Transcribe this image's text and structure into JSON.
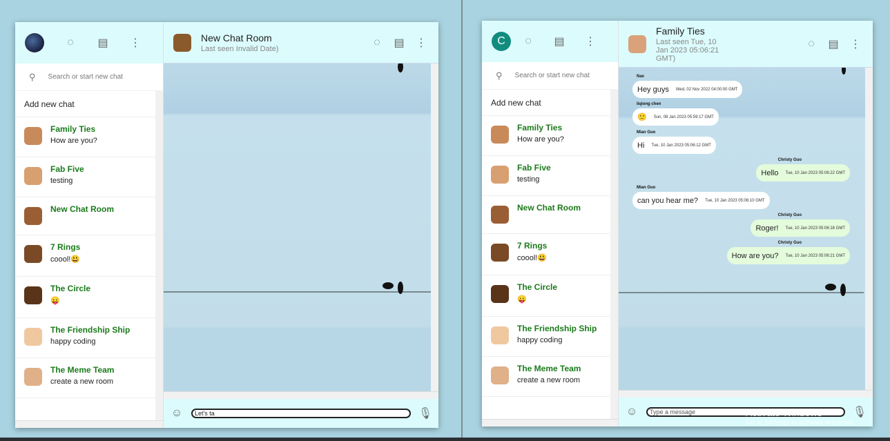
{
  "left": {
    "search_placeholder": "Search or start new chat",
    "add_new": "Add new chat",
    "chat_title": "New Chat Room",
    "chat_sub": "Last seen Invalid Date)",
    "input_value": "Let's ta"
  },
  "right": {
    "avatar_letter": "C",
    "search_placeholder": "Search or start new chat",
    "add_new": "Add new chat",
    "chat_title": "Family Ties",
    "chat_sub": "Last seen Tue, 10 Jan 2023 05:06:21 GMT)",
    "input_placeholder": "Type a message",
    "messages": [
      {
        "sender": "Nax",
        "text": "Hey guys",
        "time": "Wed, 02 Nov 2022 04:00:00 GMT",
        "mine": false
      },
      {
        "sender": "liqiong chen",
        "text": "🙂",
        "time": "Sun, 08 Jan 2023 05:59:17 GMT",
        "mine": false
      },
      {
        "sender": "Mian Guo",
        "text": "Hi",
        "time": "Tue, 10 Jan 2023 05:06:12 GMT",
        "mine": false
      },
      {
        "sender": "Christy Guo",
        "text": "Hello",
        "time": "Tue, 10 Jan 2023 05:06:22 GMT",
        "mine": true
      },
      {
        "sender": "Mian Guo",
        "text": "can you hear me?",
        "time": "Tue, 10 Jan 2023 05:06:10 GMT",
        "mine": false
      },
      {
        "sender": "Christy Guo",
        "text": "Roger!",
        "time": "Tue, 10 Jan 2023 05:06:16 GMT",
        "mine": true
      },
      {
        "sender": "Christy Guo",
        "text": "How are you?",
        "time": "Tue, 10 Jan 2023 05:06:21 GMT",
        "mine": true
      }
    ]
  },
  "rooms": [
    {
      "name": "Family Ties",
      "last": "How are you?"
    },
    {
      "name": "Fab Five",
      "last": "testing"
    },
    {
      "name": "New Chat Room",
      "last": ""
    },
    {
      "name": "7 Rings",
      "last": "coool!😃"
    },
    {
      "name": "The Circle",
      "last": "😛"
    },
    {
      "name": "The Friendship Ship",
      "last": "happy coding"
    },
    {
      "name": "The Meme Team",
      "last": "create a new room"
    }
  ],
  "watermark": {
    "title": "Activate Windows",
    "sub": "Go to Settings to activate Windows."
  },
  "icons": {
    "status": "circle-notch-icon",
    "chat": "message-icon",
    "menu": "more-vertical-icon",
    "search": "search-icon",
    "emoji": "smile-icon",
    "mic": "microphone-icon"
  },
  "colors": {
    "header": "#dcfbfc",
    "room_name": "#1b7a1b",
    "my_bubble": "#e4fbdc",
    "accent": "#128c7e"
  }
}
